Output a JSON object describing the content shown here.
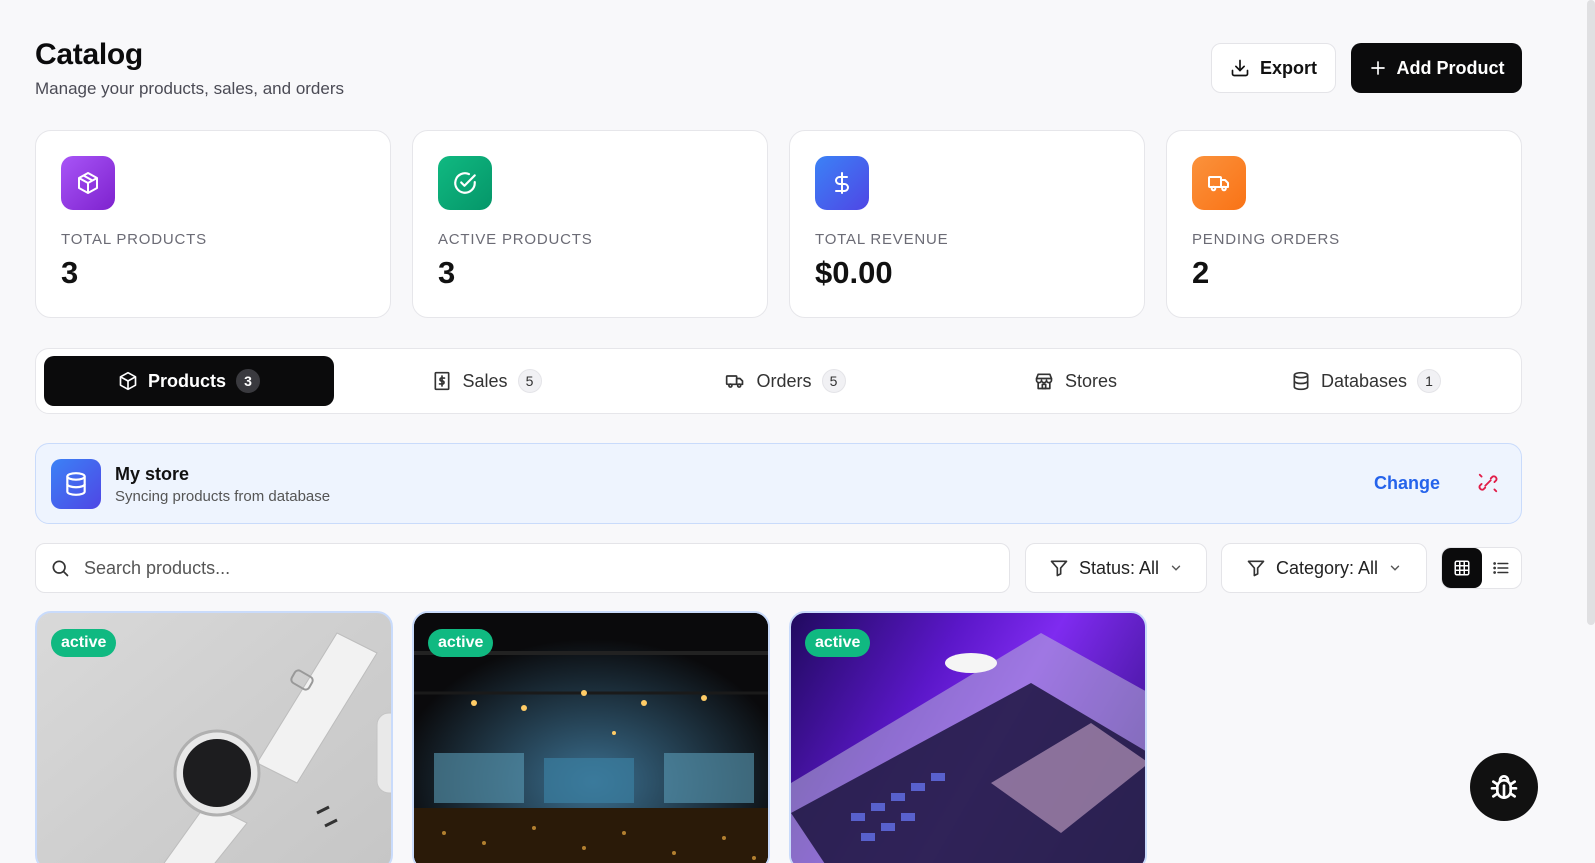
{
  "header": {
    "title": "Catalog",
    "subtitle": "Manage your products, sales, and orders",
    "export_label": "Export",
    "add_label": "Add Product"
  },
  "stats": [
    {
      "label": "TOTAL PRODUCTS",
      "value": "3",
      "icon": "package-icon",
      "color": "#9333ea"
    },
    {
      "label": "ACTIVE PRODUCTS",
      "value": "3",
      "icon": "check-circle-icon",
      "color": "#10b981"
    },
    {
      "label": "TOTAL REVENUE",
      "value": "$0.00",
      "icon": "dollar-icon",
      "color": "#4f46e5"
    },
    {
      "label": "PENDING ORDERS",
      "value": "2",
      "icon": "truck-icon",
      "color": "#f97316"
    }
  ],
  "tabs": [
    {
      "label": "Products",
      "count": "3",
      "icon": "package-icon",
      "active": true
    },
    {
      "label": "Sales",
      "count": "5",
      "icon": "receipt-icon"
    },
    {
      "label": "Orders",
      "count": "5",
      "icon": "truck-icon"
    },
    {
      "label": "Stores",
      "count": "",
      "icon": "store-icon"
    },
    {
      "label": "Databases",
      "count": "1",
      "icon": "database-icon"
    }
  ],
  "store": {
    "name": "My store",
    "subtitle": "Syncing products from database",
    "change_label": "Change"
  },
  "search": {
    "placeholder": "Search products..."
  },
  "filters": {
    "status": "Status: All",
    "category": "Category: All"
  },
  "view": {
    "selected": "grid"
  },
  "products": [
    {
      "status": "active",
      "image": "smartwatch"
    },
    {
      "status": "active",
      "image": "conference-hall"
    },
    {
      "status": "active",
      "image": "laptop"
    }
  ]
}
